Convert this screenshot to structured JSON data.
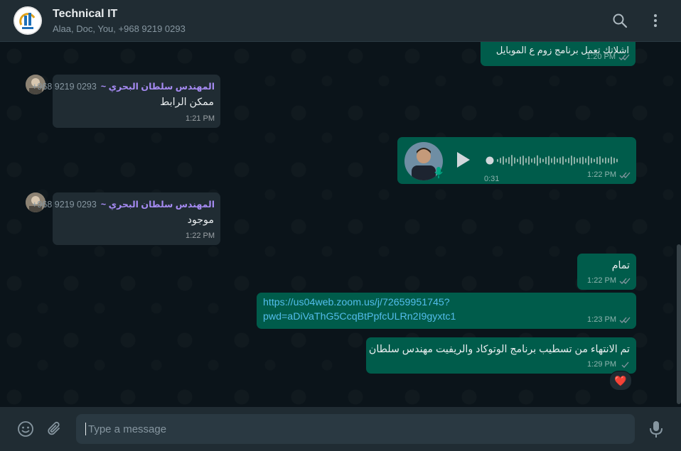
{
  "header": {
    "title": "Technical IT",
    "subtitle": "Alaa, Doc, You, +968 9219 0293",
    "search_icon": "search-icon",
    "menu_icon": "more-vertical-icon"
  },
  "messages": [
    {
      "kind": "outgoing",
      "text": "اشلاتك تعمل برنامج زوم ع الموبايل",
      "time": "1:20 PM",
      "status": "read"
    },
    {
      "kind": "incoming",
      "sender_name": "~ المهندس سلطان البحري",
      "sender_phone": "+968 9219 0293",
      "text": "ممكن الرابط",
      "time": "1:21 PM"
    },
    {
      "kind": "outgoing-voice",
      "duration": "0:31",
      "time": "1:22 PM",
      "status": "read",
      "progress": 0
    },
    {
      "kind": "incoming",
      "sender_name": "~ المهندس سلطان البحري",
      "sender_phone": "+968 9219 0293",
      "text": "موجود",
      "time": "1:22 PM"
    },
    {
      "kind": "outgoing",
      "text": "تمام",
      "time": "1:22 PM",
      "status": "read"
    },
    {
      "kind": "outgoing-link",
      "text_line1": "https://us04web.zoom.us/j/72659951745?",
      "text_line2": "pwd=aDiVaThG5CcqBtPpfcULRn2I9gyxtc1",
      "time": "1:23 PM",
      "status": "read"
    },
    {
      "kind": "outgoing",
      "text": "تم الانتهاء من تسطيب برنامج الوتوكاد والريفيت مهندس سلطان",
      "time": "1:29 PM",
      "status": "sent",
      "reaction": "❤️"
    }
  ],
  "composer": {
    "placeholder": "Type a message",
    "emoji_icon": "emoji-icon",
    "attach_icon": "paperclip-icon",
    "mic_icon": "microphone-icon"
  },
  "colors": {
    "background": "#0b141a",
    "header": "#202c33",
    "outgoing_bubble": "#005c4b",
    "incoming_bubble": "#202c33",
    "accent": "#00a884",
    "sender_name": "#a68bf3",
    "link": "#53bdeb"
  }
}
